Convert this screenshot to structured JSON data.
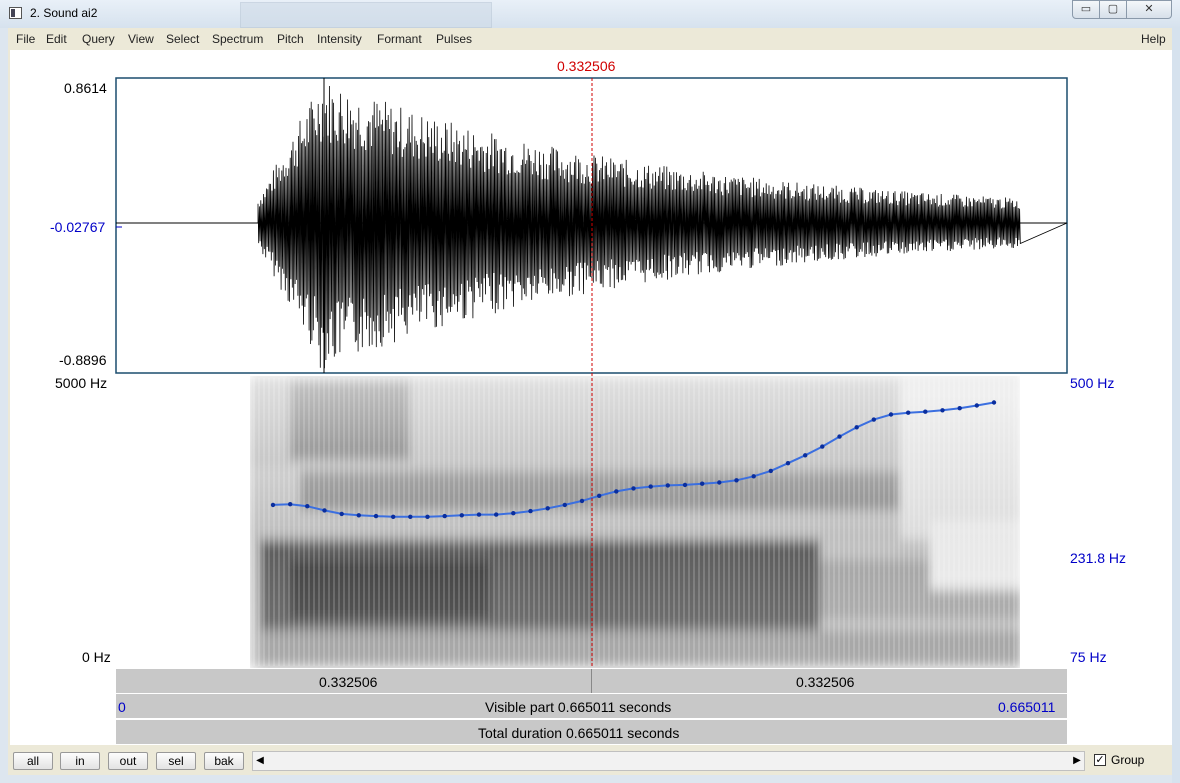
{
  "window": {
    "title": "2. Sound ai2",
    "controls": {
      "minimize": "▭",
      "maximize": "▢",
      "close": "✕"
    }
  },
  "menubar": {
    "items": [
      "File",
      "Edit",
      "Query",
      "View",
      "Select",
      "Spectrum",
      "Pitch",
      "Intensity",
      "Formant",
      "Pulses"
    ],
    "help": "Help"
  },
  "cursor": {
    "time_label": "0.332506",
    "time": 0.332506
  },
  "waveform": {
    "max_label": "0.8614",
    "zero_label": "-0.02767",
    "min_label": "-0.8896"
  },
  "spectrogram": {
    "freq_top_label": "5000 Hz",
    "freq_bottom_label": "0 Hz"
  },
  "pitch": {
    "top_label": "500 Hz",
    "mid_label": "231.8 Hz",
    "bottom_label": "75 Hz",
    "line_color": "#3b6fe0",
    "contour_hz": [
      215,
      216,
      213,
      207,
      202,
      200,
      199,
      198,
      198,
      198,
      199,
      200,
      201,
      201,
      203,
      206,
      210,
      215,
      221,
      229,
      236,
      241,
      244,
      246,
      247,
      249,
      251,
      255,
      262,
      272,
      287,
      303,
      322,
      345,
      368,
      388,
      402,
      407,
      410,
      414,
      420,
      428,
      437
    ]
  },
  "time_bars": {
    "left_segment_label": "0.332506",
    "right_segment_label": "0.332506",
    "visible_start": "0",
    "visible_label": "Visible part 0.665011 seconds",
    "visible_end": "0.665011",
    "total_label": "Total duration 0.665011 seconds"
  },
  "bottom_buttons": [
    "all",
    "in",
    "out",
    "sel",
    "bak"
  ],
  "scrollbar": {
    "left_arrow": "◀",
    "right_arrow": "▶"
  },
  "group": {
    "checked_mark": "✓",
    "label": "Group"
  },
  "colors": {
    "cursor": "#d00000",
    "axis_blue": "#0000c8"
  }
}
